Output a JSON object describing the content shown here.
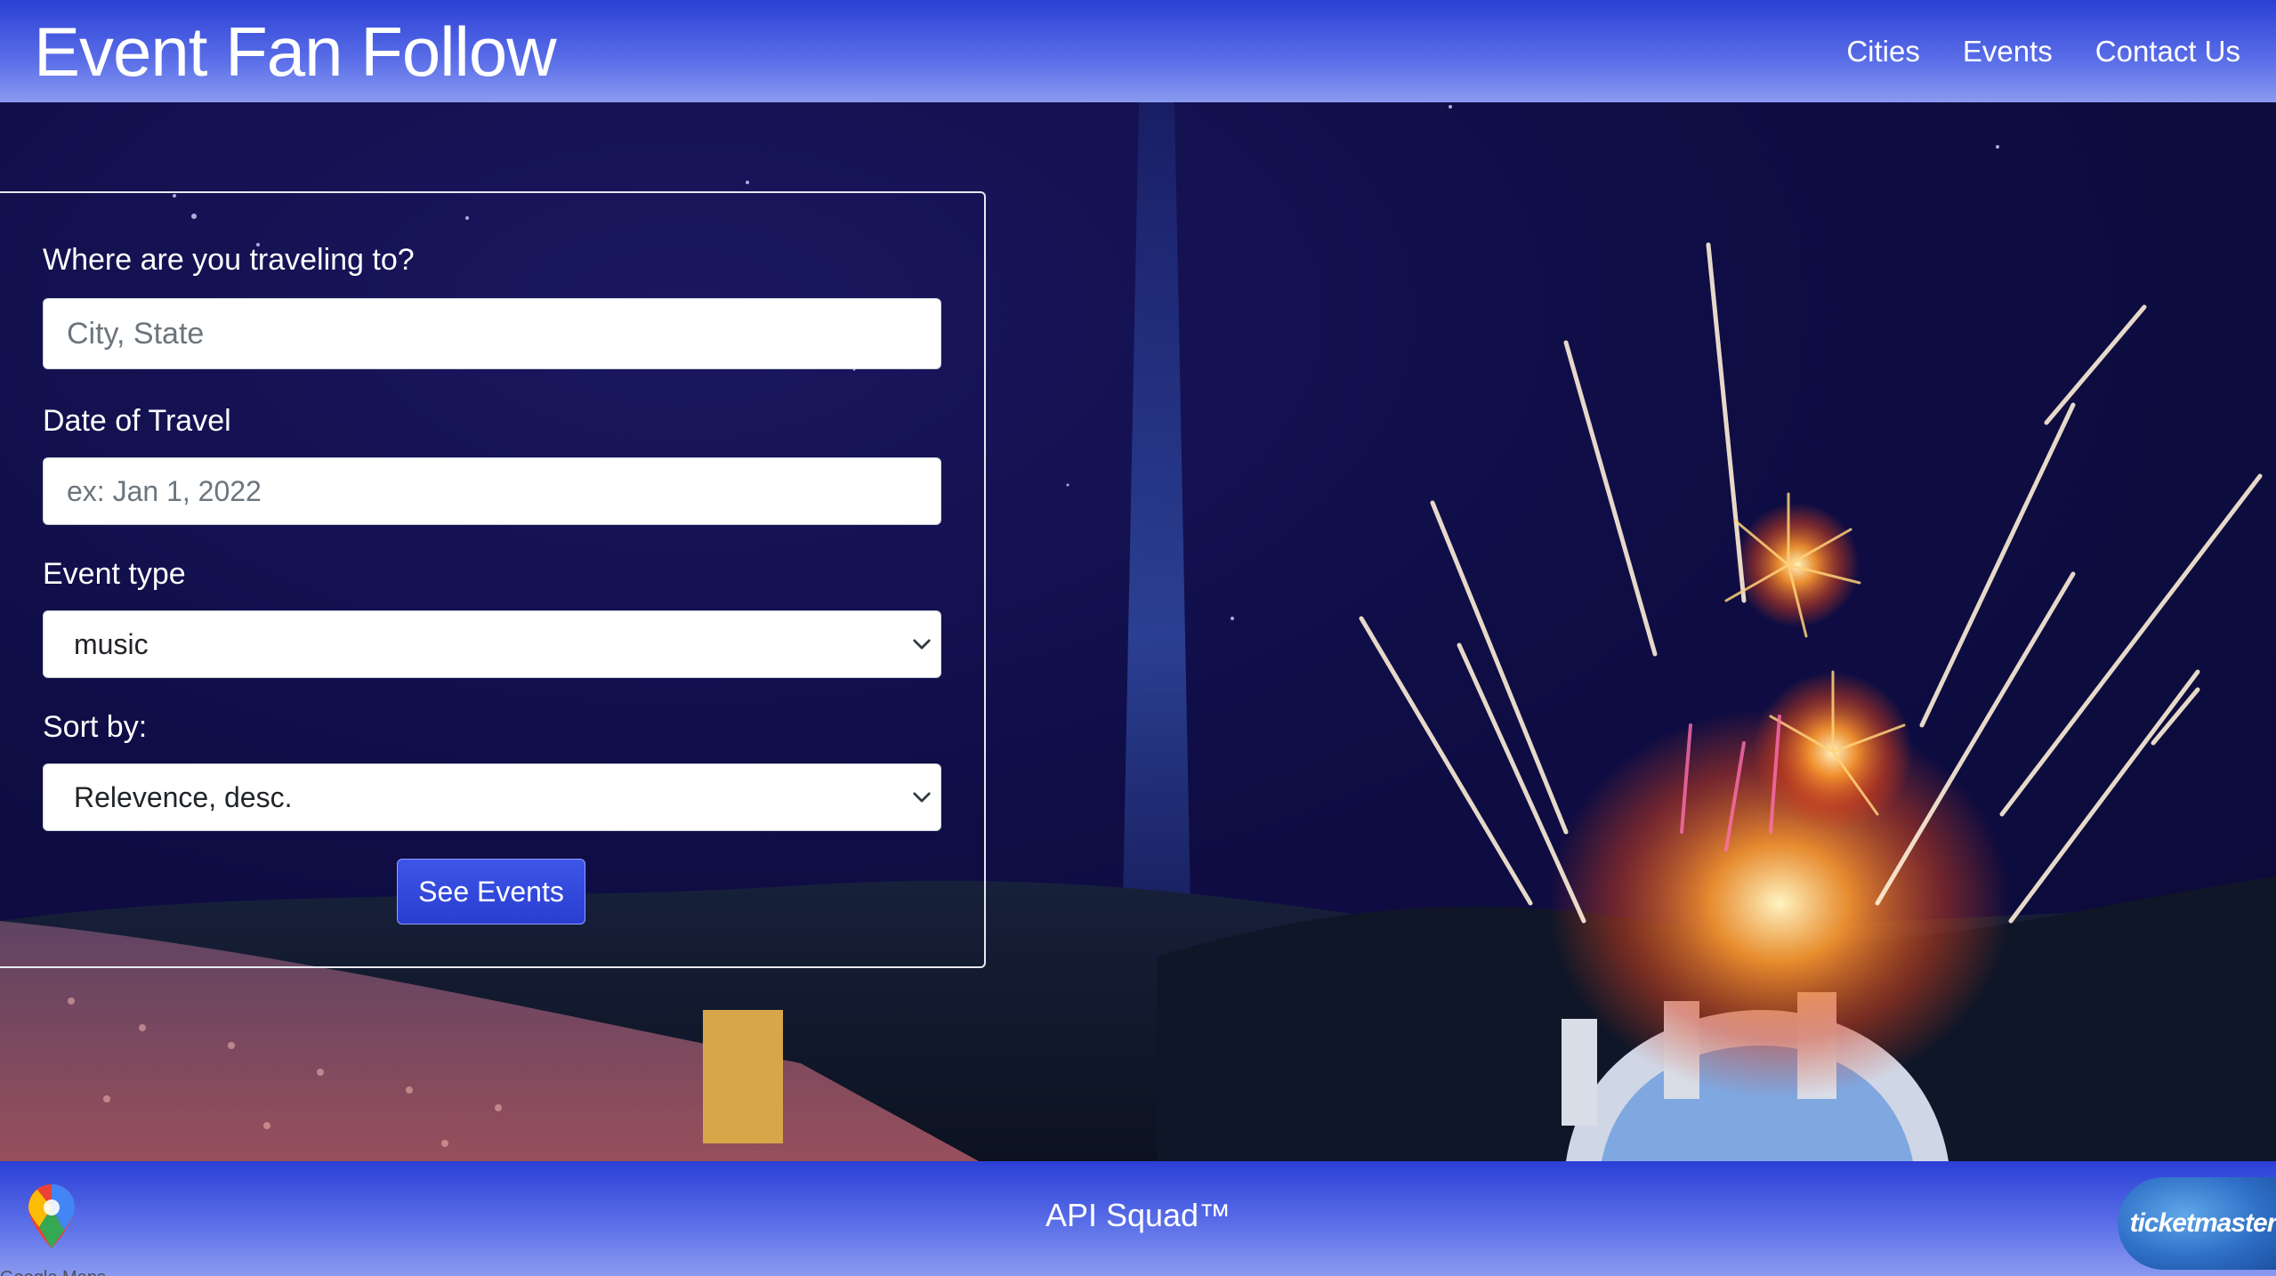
{
  "header": {
    "brand": "Event Fan Follow",
    "nav": [
      "Cities",
      "Events",
      "Contact Us"
    ]
  },
  "form": {
    "destination": {
      "label": "Where are you traveling to?",
      "value": "",
      "placeholder": "City, State"
    },
    "date": {
      "label": "Date of Travel",
      "value": "",
      "placeholder": "ex: Jan 1, 2022"
    },
    "event_type": {
      "label": "Event type",
      "selected": "music"
    },
    "sort_by": {
      "label": "Sort by:",
      "selected": "Relevence, desc."
    },
    "submit_label": "See Events"
  },
  "footer": {
    "text": "API Squad™",
    "gmaps_label": "Google Maps",
    "ticketmaster_label": "ticketmaster"
  },
  "icons": [
    "google-maps-pin-icon",
    "chevron-down-icon",
    "ticketmaster-logo"
  ],
  "colors": {
    "header_bg": "#2b3fd6",
    "button_bg": "#3d55e8",
    "hero_bg": "#0f0d45"
  }
}
